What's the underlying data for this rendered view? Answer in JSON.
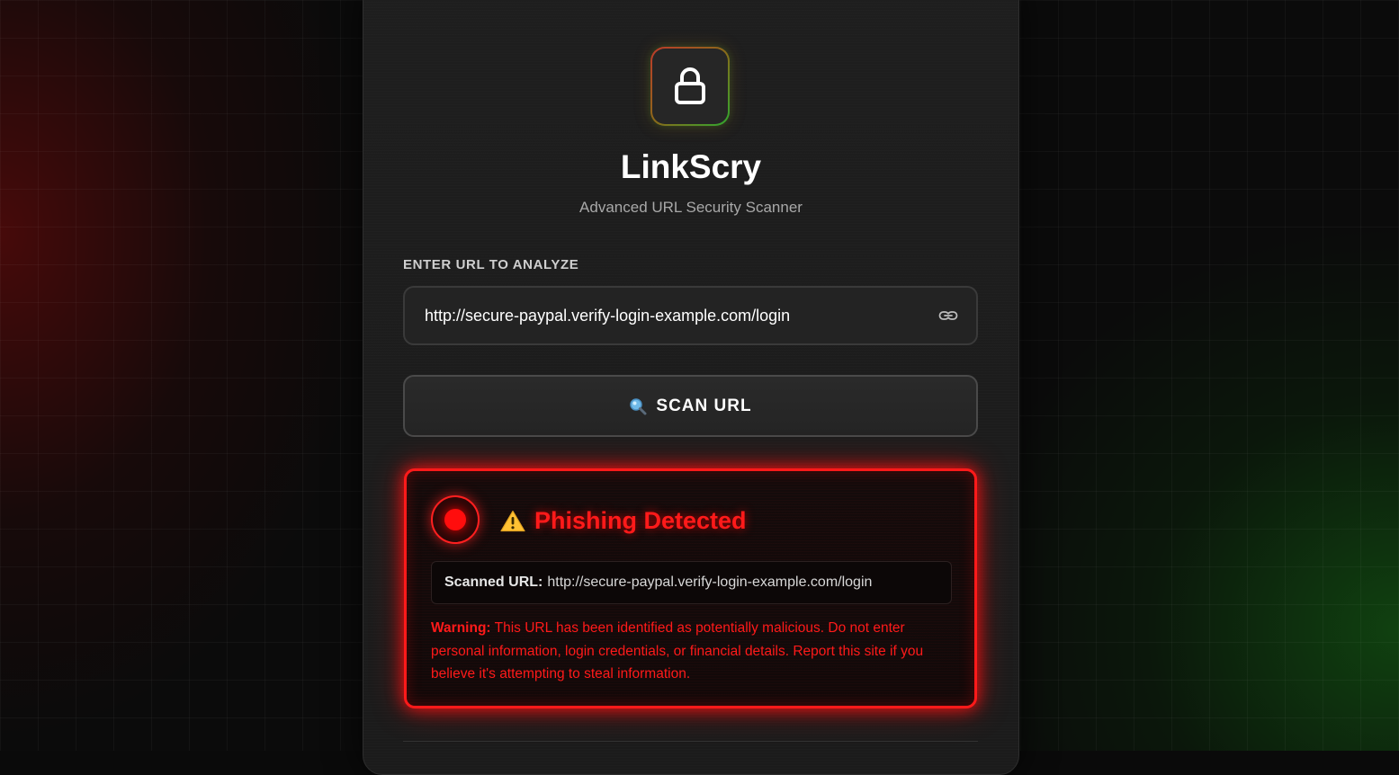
{
  "app": {
    "title": "LinkScry",
    "subtitle": "Advanced URL Security Scanner",
    "logo_icon": "lock-icon"
  },
  "form": {
    "label": "ENTER URL TO ANALYZE",
    "url_value": "http://secure-paypal.verify-login-example.com/login",
    "input_icon": "link-icon",
    "scan_button": {
      "icon": "magnifying-glass-icon",
      "label": "SCAN URL"
    }
  },
  "result": {
    "status": "phishing",
    "icon": "warning-icon",
    "title": "Phishing Detected",
    "scanned_label": "Scanned URL:",
    "scanned_url": "http://secure-paypal.verify-login-example.com/login",
    "warning_label": "Warning:",
    "warning_text": "This URL has been identified as potentially malicious. Do not enter personal information, login credentials, or financial details. Report this site if you believe it's attempting to steal information.",
    "color": "#ff1a1a"
  }
}
